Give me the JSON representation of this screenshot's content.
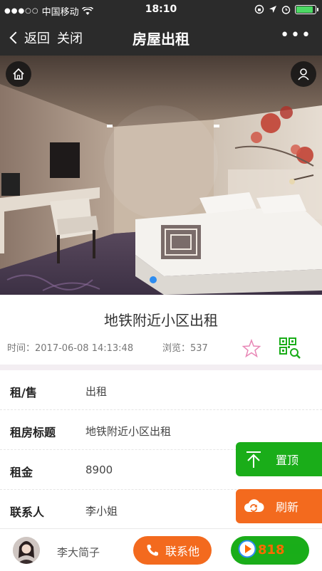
{
  "status_bar": {
    "carrier": "中国移动",
    "time": "18:10"
  },
  "nav": {
    "back_label": "返回",
    "close_label": "关闭",
    "title": "房屋出租",
    "more_label": "•••"
  },
  "listing": {
    "title": "地铁附近小区出租",
    "time_label": "时间：",
    "time_value": "2017-06-08 14:13:48",
    "views_label": "浏览：",
    "views_value": "537"
  },
  "details": [
    {
      "label": "租/售",
      "value": "出租"
    },
    {
      "label": "租房标题",
      "value": "地铁附近小区出租"
    },
    {
      "label": "租金",
      "value": "8900"
    },
    {
      "label": "联系人",
      "value": "李小姐"
    }
  ],
  "floating": {
    "top_label": "置顶",
    "refresh_label": "刷新"
  },
  "bottom": {
    "author": "李大简子",
    "call_label": "联系他"
  },
  "colors": {
    "green": "#1aad19",
    "orange": "#f36a1e",
    "dark_bar": "#2b2b2b",
    "dot_blue": "#2d8cf0"
  },
  "battery_level": 0.9
}
